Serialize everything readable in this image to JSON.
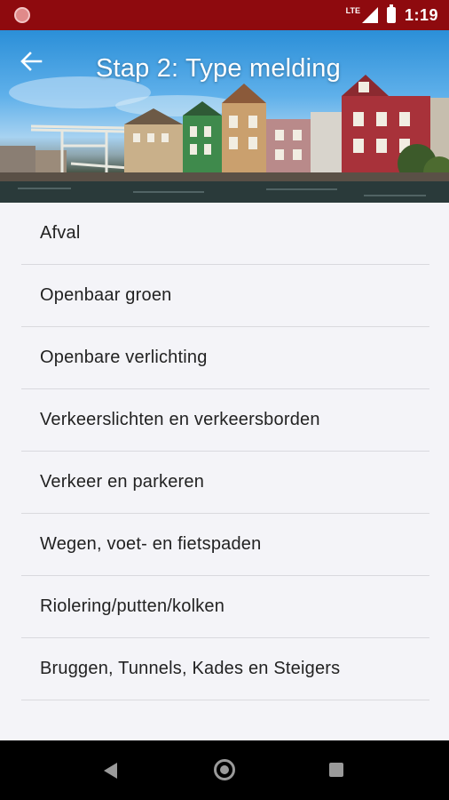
{
  "status_bar": {
    "network": "LTE",
    "time": "1:19",
    "icons": [
      "notification-dot-icon",
      "signal-icon",
      "battery-icon"
    ]
  },
  "header": {
    "title": "Stap 2: Type melding",
    "back_icon": "arrow-left-icon"
  },
  "list": {
    "items": [
      {
        "label": "Afval"
      },
      {
        "label": "Openbaar groen"
      },
      {
        "label": "Openbare verlichting"
      },
      {
        "label": "Verkeerslichten en verkeersborden"
      },
      {
        "label": "Verkeer en parkeren"
      },
      {
        "label": "Wegen, voet- en fietspaden"
      },
      {
        "label": "Riolering/putten/kolken"
      },
      {
        "label": "Bruggen, Tunnels, Kades en Steigers"
      }
    ]
  },
  "nav_bar": {
    "icons": [
      "back-triangle-icon",
      "home-circle-icon",
      "recents-square-icon"
    ]
  },
  "colors": {
    "status_bar": "#8e0a0e",
    "list_background": "#f4f4f8",
    "divider": "#d9d9de",
    "text": "#222222"
  }
}
